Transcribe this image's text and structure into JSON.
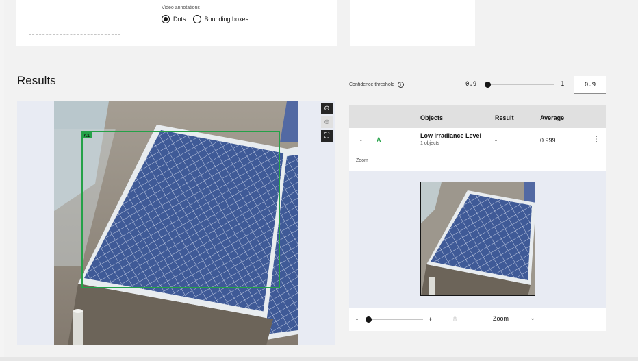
{
  "upload": {
    "video_annotations_label": "Video annotations",
    "options": [
      {
        "label": "Dots",
        "selected": true
      },
      {
        "label": "Bounding boxes",
        "selected": false
      }
    ]
  },
  "results": {
    "title": "Results",
    "box_label": "A1",
    "tools": {
      "zoom_in": "⊕",
      "zoom_out": "⊖",
      "fit": "⛶"
    }
  },
  "confidence": {
    "label": "Confidence threshold",
    "info": "i",
    "min": "0.9",
    "max": "1",
    "value": "0.9"
  },
  "table": {
    "headers": [
      "Objects",
      "Result",
      "Average"
    ],
    "rows": [
      {
        "tag": "A",
        "object": "Low Irradiance Level",
        "count": "1 objects",
        "result": "-",
        "average": "0.999"
      }
    ]
  },
  "zoom": {
    "label": "Zoom",
    "minus": "-",
    "plus": "+",
    "value": "8",
    "select": "Zoom"
  },
  "colors": {
    "accent_green": "#24a148",
    "panel_bg": "#e8ebf3"
  }
}
